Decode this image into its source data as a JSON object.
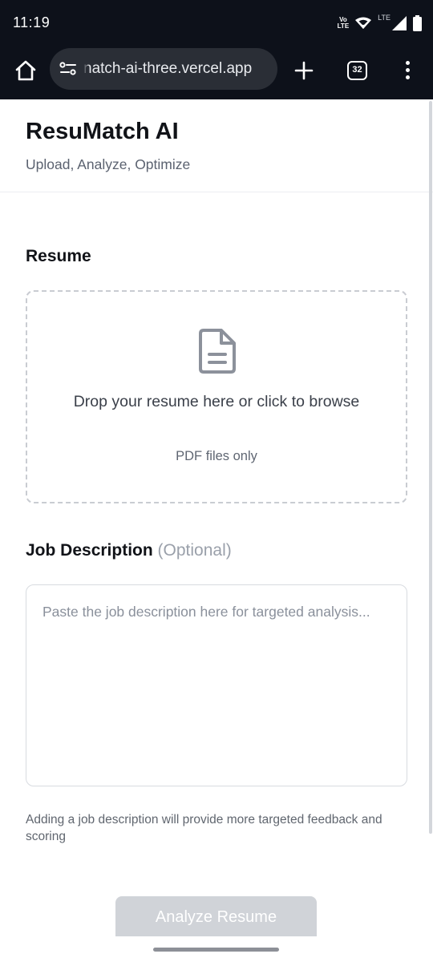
{
  "status_bar": {
    "time": "11:19",
    "volte_top": "Vo",
    "volte_bottom": "LTE",
    "network": "LTE",
    "icons": [
      "volte-icon",
      "wifi-icon",
      "signal-icon",
      "battery-icon"
    ]
  },
  "browser": {
    "url": "natch-ai-three.vercel.app",
    "tab_count": "32",
    "icons": [
      "home-icon",
      "site-settings-icon",
      "new-tab-icon",
      "tabs-icon",
      "menu-icon"
    ]
  },
  "app": {
    "title": "ResuMatch AI",
    "subtitle": "Upload, Analyze, Optimize"
  },
  "resume": {
    "heading": "Resume",
    "drop_text": "Drop your resume here or click to browse",
    "drop_subtext": "PDF files only",
    "icon": "document-icon"
  },
  "job_description": {
    "heading": "Job Description",
    "optional_label": "(Optional)",
    "placeholder": "Paste the job description here for targeted analysis...",
    "value": "",
    "hint": "Adding a job description will provide more targeted feedback and scoring"
  },
  "actions": {
    "analyze_label": "Analyze Resume",
    "analyze_enabled": false
  },
  "colors": {
    "chrome_bg": "#0d111a",
    "url_pill": "#2a2e36",
    "disabled_button": "#d0d3d8",
    "dashed_border": "#c9ccd2"
  }
}
